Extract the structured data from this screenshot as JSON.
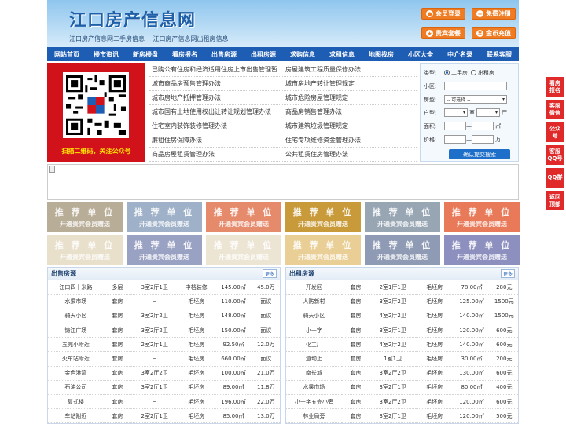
{
  "header": {
    "logo": "江口房产信息网",
    "sublinks": [
      "江口房产信息网二手房信息",
      "江口房产信息网出租房信息"
    ],
    "buttons": [
      {
        "label": "会员登录",
        "icon": "user-icon"
      },
      {
        "label": "免费注册",
        "icon": "plus-icon"
      },
      {
        "label": "贵宾套餐",
        "icon": "star-icon"
      },
      {
        "label": "金币充值",
        "icon": "coin-icon"
      }
    ]
  },
  "nav": [
    "网站首页",
    "楼市资讯",
    "新房楼盘",
    "看房报名",
    "出售房源",
    "出租房源",
    "求购信息",
    "求租信息",
    "地图找房",
    "小区大全",
    "中介名录",
    "联系客服"
  ],
  "qr": {
    "caption": "扫描二维码，关注公众号"
  },
  "links": [
    [
      "已购公有住房和经济适用住房上市出售管理暂",
      "房屋建筑工程质量保修办法"
    ],
    [
      "城市商品房预售管理办法",
      "城市房地产转让管理规定"
    ],
    [
      "城市房地产抵押管理办法",
      "城市危险房屋管理规定"
    ],
    [
      "城市国有土地使用权出让转让规划管理办法",
      "商品房销售管理办法"
    ],
    [
      "住宅室内装饰装修管理办法",
      "城市建筑垃圾管理规定"
    ],
    [
      "廉租住房保障办法",
      "住宅专项维修资金管理办法"
    ],
    [
      "商品房屋租赁管理办法",
      "公共租赁住房管理办法"
    ]
  ],
  "search": {
    "type_label": "类型:",
    "opt_sale": "二手房",
    "opt_rent": "出租房",
    "community_label": "小区:",
    "housetype_label": "房型:",
    "housetype_value": "-- 可选择 --",
    "layout_label": "户型:",
    "room_unit": "室",
    "hall_unit": "厅",
    "area_label": "面积:",
    "area_unit": "㎡",
    "price_label": "价格:",
    "price_unit": "万",
    "range_sep": "—",
    "submit": "确认提交搜索"
  },
  "ads": {
    "title": "推 荐 单 位",
    "subtitle": "开通贵宾会员赠送",
    "colors": [
      "#b8ad97",
      "#9eb1c9",
      "#e68a6c",
      "#c99a3a",
      "#98a6b4",
      "#e87a5a",
      "#e9e0cc",
      "#9aa2c4",
      "#ece5d4",
      "#e9cf95",
      "#8f9bb4",
      "#8d8fbf"
    ]
  },
  "sale": {
    "title": "出售房源",
    "more": "更多",
    "rows": [
      [
        "江口四十米路",
        "多层",
        "3室2厅1卫",
        "中档装修",
        "145.00㎡",
        "45.0万"
      ],
      [
        "水果市场",
        "套房",
        "─",
        "毛坯房",
        "110.00㎡",
        "面议"
      ],
      [
        "骑天小区",
        "套房",
        "3室2厅2卫",
        "毛坯房",
        "148.00㎡",
        "面议"
      ],
      [
        "铸江广场",
        "套房",
        "3室2厅2卫",
        "毛坯房",
        "150.00㎡",
        "面议"
      ],
      [
        "五完小附近",
        "套房",
        "2室2厅1卫",
        "毛坯房",
        "92.50㎡",
        "12.0万"
      ],
      [
        "火车站附近",
        "套房",
        "─",
        "毛坯房",
        "660.00㎡",
        "面议"
      ],
      [
        "金色港湾",
        "套房",
        "3室2厅2卫",
        "毛坯房",
        "100.00㎡",
        "21.0万"
      ],
      [
        "石油公司",
        "套房",
        "3室2厅1卫",
        "毛坯房",
        "89.00㎡",
        "11.8万"
      ],
      [
        "复式楼",
        "套房",
        "─",
        "毛坯房",
        "196.00㎡",
        "22.0万"
      ],
      [
        "车站附近",
        "套房",
        "2室2厅1卫",
        "毛坯房",
        "85.00㎡",
        "13.0万"
      ]
    ]
  },
  "rent": {
    "title": "出租房源",
    "more": "更多",
    "rows": [
      [
        "开发区",
        "套房",
        "2室1厅1卫",
        "毛坯房",
        "78.00㎡",
        "280元"
      ],
      [
        "人防新村",
        "套房",
        "3室2厅2卫",
        "毛坯房",
        "125.00㎡",
        "1500元"
      ],
      [
        "骑天小区",
        "套房",
        "4室2厅2卫",
        "毛坯房",
        "140.00㎡",
        "1500元"
      ],
      [
        "小十字",
        "套房",
        "3室2厅1卫",
        "毛坯房",
        "120.00㎡",
        "600元"
      ],
      [
        "化工厂",
        "套房",
        "4室2厅2卫",
        "毛坯房",
        "140.00㎡",
        "600元"
      ],
      [
        "道坳上",
        "套房",
        "1室1卫",
        "毛坯房",
        "30.00㎡",
        "200元"
      ],
      [
        "南长城",
        "套房",
        "3室2厅2卫",
        "毛坯房",
        "130.00㎡",
        "600元"
      ],
      [
        "水果市场",
        "套房",
        "3室2厅1卫",
        "毛坯房",
        "80.00㎡",
        "400元"
      ],
      [
        "小十字五完小旁",
        "套房",
        "3室2厅2卫",
        "毛坯房",
        "120.00㎡",
        "600元"
      ],
      [
        "林业局旁",
        "套房",
        "3室2厅1卫",
        "毛坯房",
        "120.00㎡",
        "500元"
      ]
    ]
  },
  "side": [
    "看房报名",
    "客服微信",
    "公众号",
    "客服QQ号",
    "QQ群",
    "返回顶部"
  ]
}
